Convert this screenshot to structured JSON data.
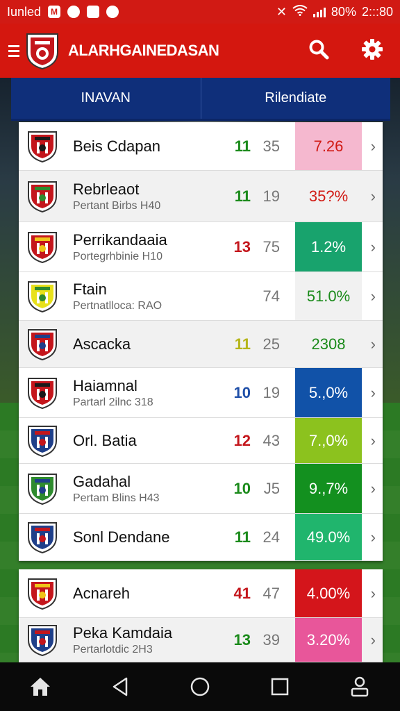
{
  "status_bar": {
    "carrier": "Iunled",
    "badge1": "M",
    "battery": "80%",
    "time": "2:::80"
  },
  "app_bar": {
    "title": "ALARHGAINEDASAN"
  },
  "tabs": [
    {
      "label": "INAVAN"
    },
    {
      "label": "Rilendiate"
    }
  ],
  "main_list": [
    {
      "name": "Beis Cdapan",
      "subtitle": "",
      "stat1": "11",
      "stat2": "35",
      "percent": "7.26",
      "stat1_color": "#1a8a1a",
      "percent_bg": "#f5b8cf",
      "percent_color": "#d11a14",
      "crest_colors": [
        "#c4161c",
        "#1a1a1a"
      ]
    },
    {
      "name": "Rebrleaot",
      "subtitle": "Pertant Birbs H40",
      "stat1": "11",
      "stat2": "19",
      "percent": "35?%",
      "stat1_color": "#1a8a1a",
      "percent_bg": "#f1f1f1",
      "percent_color": "#d11a14",
      "crest_colors": [
        "#c4161c",
        "#2e8b2e"
      ]
    },
    {
      "name": "Perrikandaaia",
      "subtitle": "Portegrhbinie H10",
      "stat1": "13",
      "stat2": "75",
      "percent": "1.2%",
      "stat1_color": "#c4161c",
      "percent_bg": "#18a36d",
      "percent_color": "#ffffff",
      "crest_colors": [
        "#c4161c",
        "#f0c419"
      ]
    },
    {
      "name": "Ftain",
      "subtitle": "Pertnatlloca: RAO",
      "stat1": "",
      "stat2": "74",
      "percent": "51.0%",
      "stat1_color": "#1a8a1a",
      "percent_bg": "#f1f1f1",
      "percent_color": "#1a8a1a",
      "crest_colors": [
        "#e8e11b",
        "#2e8b2e"
      ]
    },
    {
      "name": "Ascacka",
      "subtitle": "",
      "stat1": "11",
      "stat2": "25",
      "percent": "2308",
      "stat1_color": "#b5b51a",
      "percent_bg": "#f1f1f1",
      "percent_color": "#1a8a1a",
      "crest_colors": [
        "#c4161c",
        "#1f3f8a"
      ]
    },
    {
      "name": "Haiamnal",
      "subtitle": "Partarl 2ilnc 318",
      "stat1": "10",
      "stat2": "19",
      "percent": "5.,0%",
      "stat1_color": "#1f4fa8",
      "percent_bg": "#1152a8",
      "percent_color": "#ffffff",
      "crest_colors": [
        "#c4161c",
        "#1a1a1a"
      ]
    },
    {
      "name": "Orl. Batia",
      "subtitle": "",
      "stat1": "12",
      "stat2": "43",
      "percent": "7.,0%",
      "stat1_color": "#c4161c",
      "percent_bg": "#8cc21e",
      "percent_color": "#ffffff",
      "crest_colors": [
        "#1f3f8a",
        "#c4161c"
      ]
    },
    {
      "name": "Gadahal",
      "subtitle": "Pertam Blins H43",
      "stat1": "10",
      "stat2": "J5",
      "percent": "9.,7%",
      "stat1_color": "#1a8a1a",
      "percent_bg": "#13901f",
      "percent_color": "#ffffff",
      "crest_colors": [
        "#2e8b2e",
        "#1f3f8a"
      ]
    },
    {
      "name": "Sonl Dendane",
      "subtitle": "",
      "stat1": "11",
      "stat2": "24",
      "percent": "49.0%",
      "stat1_color": "#1a8a1a",
      "percent_bg": "#20b56d",
      "percent_color": "#ffffff",
      "crest_colors": [
        "#1f3f8a",
        "#c4161c"
      ]
    }
  ],
  "second_list": [
    {
      "name": "Acnareh",
      "subtitle": "",
      "stat1": "41",
      "stat2": "47",
      "percent": "4.00%",
      "stat1_color": "#c4161c",
      "percent_bg": "#d4151b",
      "percent_color": "#ffffff",
      "crest_colors": [
        "#c4161c",
        "#f0c419"
      ]
    },
    {
      "name": "Peka Kamdaia",
      "subtitle": "Pertarlotdic 2H3",
      "stat1": "13",
      "stat2": "39",
      "percent": "3.20%",
      "stat1_color": "#1a8a1a",
      "percent_bg": "#e8569a",
      "percent_color": "#ffffff",
      "crest_colors": [
        "#1f3f8a",
        "#c4161c"
      ]
    }
  ],
  "colors": {
    "primary": "#d4170f",
    "tab_bar": "#0f2f7a"
  },
  "icons": [
    "menu-icon",
    "search-icon",
    "gear-icon",
    "chevron-right-icon",
    "home-icon",
    "back-icon",
    "home-circle-icon",
    "recents-icon",
    "account-icon"
  ]
}
